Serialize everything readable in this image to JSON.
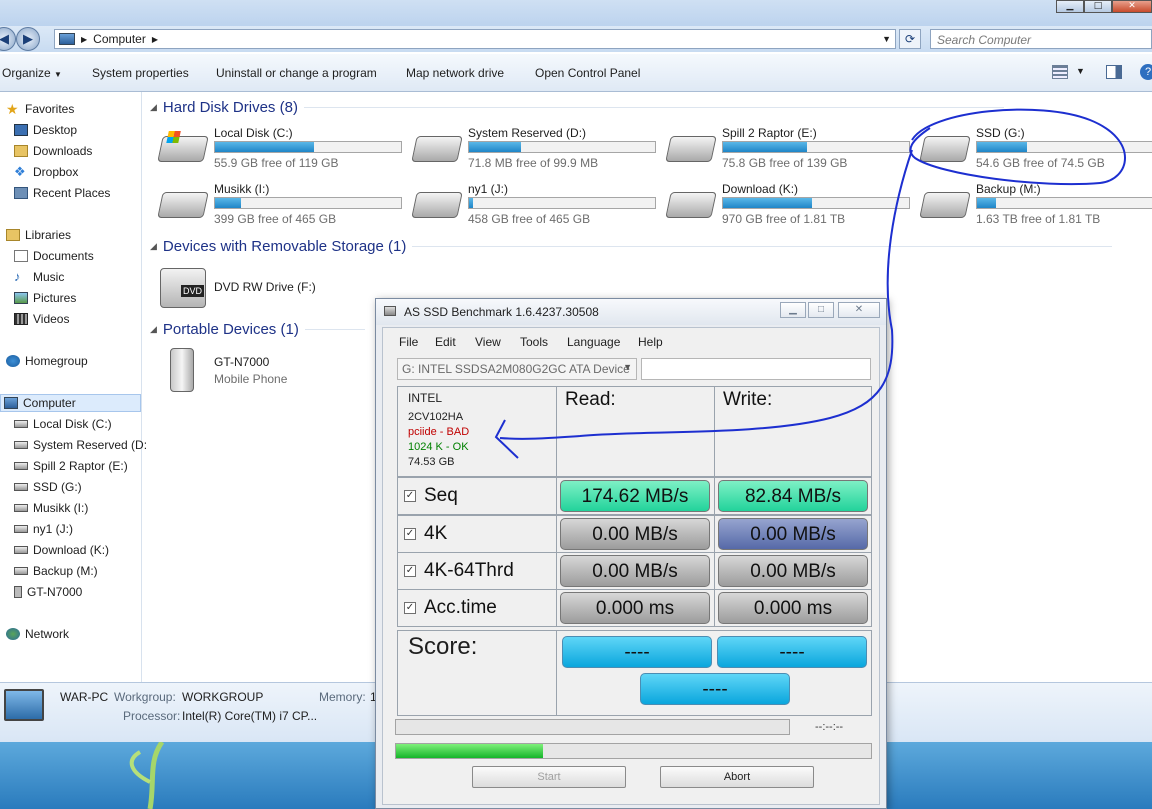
{
  "explorer": {
    "breadcrumb": [
      "Computer"
    ],
    "search_placeholder": "Search Computer",
    "toolbar": {
      "organize": "Organize",
      "system_properties": "System properties",
      "uninstall": "Uninstall or change a program",
      "map_network": "Map network drive",
      "control_panel": "Open Control Panel"
    },
    "nav": {
      "favorites": "Favorites",
      "desktop": "Desktop",
      "downloads": "Downloads",
      "dropbox": "Dropbox",
      "recent": "Recent Places",
      "libraries": "Libraries",
      "documents": "Documents",
      "music": "Music",
      "pictures": "Pictures",
      "videos": "Videos",
      "homegroup": "Homegroup",
      "computer": "Computer",
      "drives": [
        "Local Disk (C:)",
        "System Reserved (D:",
        "Spill 2 Raptor (E:)",
        "SSD  (G:)",
        "Musikk (I:)",
        "ny1 (J:)",
        "Download (K:)",
        "Backup  (M:)",
        "GT-N7000"
      ],
      "network": "Network"
    },
    "groups": {
      "hdd": "Hard Disk Drives (8)",
      "removable": "Devices with Removable Storage (1)",
      "portable": "Portable Devices (1)"
    },
    "hard_drives": [
      {
        "name": "Local Disk (C:)",
        "free": "55.9 GB free of 119 GB",
        "used_fraction": 0.53
      },
      {
        "name": "System Reserved (D:)",
        "free": "71.8 MB free of 99.9 MB",
        "used_fraction": 0.28
      },
      {
        "name": "Spill 2 Raptor (E:)",
        "free": "75.8 GB free of 139 GB",
        "used_fraction": 0.45
      },
      {
        "name": "SSD  (G:)",
        "free": "54.6 GB free of 74.5 GB",
        "used_fraction": 0.27
      },
      {
        "name": "Musikk (I:)",
        "free": "399 GB free of 465 GB",
        "used_fraction": 0.14
      },
      {
        "name": "ny1 (J:)",
        "free": "458 GB free of 465 GB",
        "used_fraction": 0.02
      },
      {
        "name": "Download (K:)",
        "free": "970 GB free of 1.81 TB",
        "used_fraction": 0.48
      },
      {
        "name": "Backup  (M:)",
        "free": "1.63 TB free of 1.81 TB",
        "used_fraction": 0.1
      }
    ],
    "dvd": {
      "name": "DVD RW Drive (F:)",
      "icon_label": "DVD"
    },
    "phone": {
      "name": "GT-N7000",
      "type": "Mobile Phone"
    },
    "details": {
      "pc_name": "WAR-PC",
      "workgroup_label": "Workgroup:",
      "workgroup": "WORKGROUP",
      "memory_label": "Memory:",
      "memory": "1",
      "processor_label": "Processor:",
      "processor": "Intel(R) Core(TM) i7 CP..."
    }
  },
  "benchmark": {
    "title": "AS SSD Benchmark 1.6.4237.30508",
    "menu": [
      "File",
      "Edit",
      "View",
      "Tools",
      "Language",
      "Help"
    ],
    "device": "G: INTEL SSDSA2M080G2GC ATA Device",
    "info": {
      "vendor": "INTEL",
      "firmware": "2CV102HA",
      "driver": "pciide - BAD",
      "alignment": "1024 K - OK",
      "size": "74.53 GB"
    },
    "read_header": "Read:",
    "write_header": "Write:",
    "rows": [
      {
        "label": "Seq",
        "read": "174.62 MB/s",
        "write": "82.84 MB/s"
      },
      {
        "label": "4K",
        "read": "0.00 MB/s",
        "write": "0.00 MB/s"
      },
      {
        "label": "4K-64Thrd",
        "read": "0.00 MB/s",
        "write": "0.00 MB/s"
      },
      {
        "label": "Acc.time",
        "read": "0.000 ms",
        "write": "0.000 ms"
      }
    ],
    "score_label": "Score:",
    "score_read": "----",
    "score_write": "----",
    "score_total": "----",
    "time": "--:--:--",
    "progress_fraction": 0.31,
    "start": "Start",
    "abort": "Abort",
    "colors": {
      "good": "#2bd9a0",
      "busy": "#5b6ca9",
      "idle": "#a8a8a8",
      "score": "#17b2e6",
      "bad": "#c00000",
      "ok": "#008000"
    }
  }
}
